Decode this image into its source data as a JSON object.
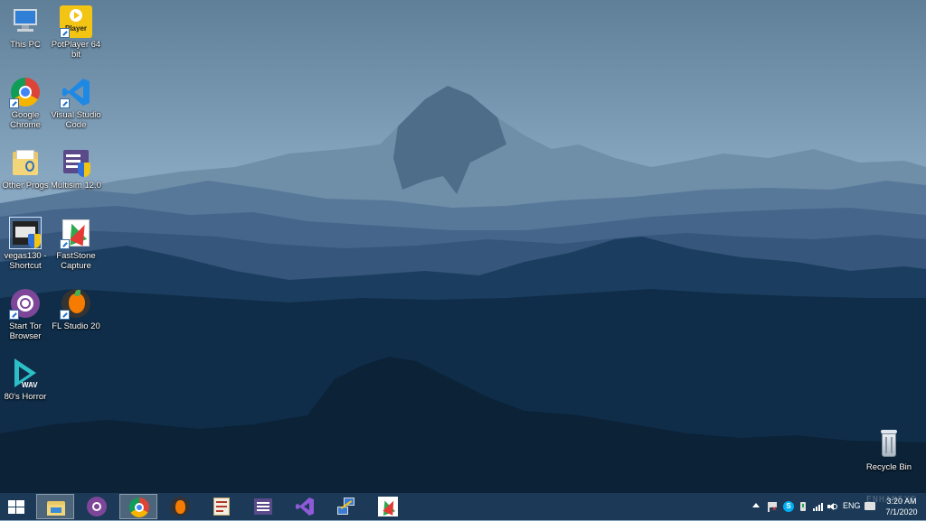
{
  "desktop": {
    "icons": [
      {
        "label": "This PC"
      },
      {
        "label": "PotPlayer 64 bit"
      },
      {
        "label": "Google Chrome"
      },
      {
        "label": "Visual Studio Code"
      },
      {
        "label": "Other Progs"
      },
      {
        "label": "Multisim 12.0"
      },
      {
        "label": "vegas130 - Shortcut"
      },
      {
        "label": "FastStone Capture"
      },
      {
        "label": "Start Tor Browser"
      },
      {
        "label": "FL Studio 20"
      },
      {
        "label": "80's Horror"
      },
      {
        "label": "Recycle Bin"
      }
    ],
    "potplayer_badge": "Player",
    "wav_badge": "WAV"
  },
  "taskbar": {
    "apps": [
      "start-menu",
      "file-explorer",
      "tor-browser",
      "google-chrome",
      "fl-studio",
      "vegas",
      "multisim",
      "visual-studio",
      "network-tool",
      "faststone-capture"
    ],
    "tray": {
      "language": "ENG",
      "time": "3:20 AM",
      "date": "7/1/2020",
      "watermark": "ENHANSYS"
    }
  },
  "colors": {
    "sky": "#7fa0bb",
    "taskbar": "#1c3a57",
    "deep_mountain": "#0f2d49"
  }
}
